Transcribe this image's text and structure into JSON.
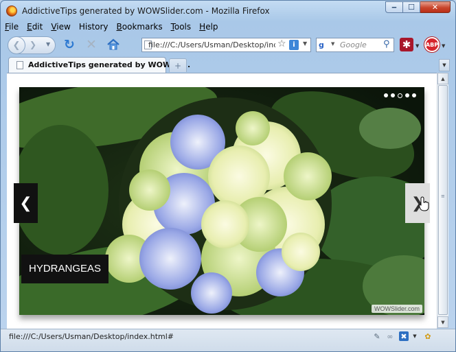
{
  "window": {
    "title": "AddictiveTips generated by WOWSlider.com - Mozilla Firefox",
    "minimize_glyph": "‒",
    "maximize_glyph": "☐",
    "close_glyph": "✕"
  },
  "menu": {
    "items": [
      {
        "key": "F",
        "rest": "ile"
      },
      {
        "key": "E",
        "rest": "dit"
      },
      {
        "key": "V",
        "rest": "iew"
      },
      {
        "key": "Hi",
        "rest": "story",
        "underline_index": 2
      },
      {
        "key": "B",
        "rest": "ookmarks"
      },
      {
        "key": "T",
        "rest": "ools"
      },
      {
        "key": "H",
        "rest": "elp"
      }
    ]
  },
  "toolbar": {
    "back_glyph": "❮",
    "forward_glyph": "❯",
    "history_drop_glyph": "▼",
    "reload_glyph": "↻",
    "stop_glyph": "✕",
    "url": "file:///C:/Users/Usman/Desktop/index",
    "star_glyph": "☆",
    "info_glyph": "i",
    "url_drop_glyph": "▼",
    "search_engine_glyph": "g",
    "search_placeholder": "Google",
    "search_icon_glyph": "⚲",
    "ext1_glyph": "✱",
    "abp_label": "ABP",
    "ext_drop_glyph": "▼"
  },
  "tabs": [
    {
      "label": "AddictiveTips generated by WOWSli...",
      "active": true
    }
  ],
  "tabstrip": {
    "new_tab_glyph": "+",
    "tab_list_glyph": "▼"
  },
  "slider": {
    "caption": "HYDRANGEAS",
    "watermark": "WOWSlider.com",
    "prev_glyph": "❮",
    "next_glyph": "❯",
    "dots_total": 5,
    "dots_active_index": 2
  },
  "scrollbar": {
    "up_glyph": "▲",
    "down_glyph": "▼",
    "grip_glyph": "≡"
  },
  "status": {
    "text": "file:///C:/Users/Usman/Desktop/index.html#",
    "icon1_glyph": "✎",
    "icon2_glyph": "∞",
    "icon3_glyph": "✖",
    "icon3_drop_glyph": "▼",
    "icon4_glyph": "✿"
  },
  "colors": {
    "accent": "#2d79d1",
    "leaf": "#3e6a2c",
    "petal_blue": "#8c9fe0",
    "petal_cream": "#f3f3c4"
  }
}
